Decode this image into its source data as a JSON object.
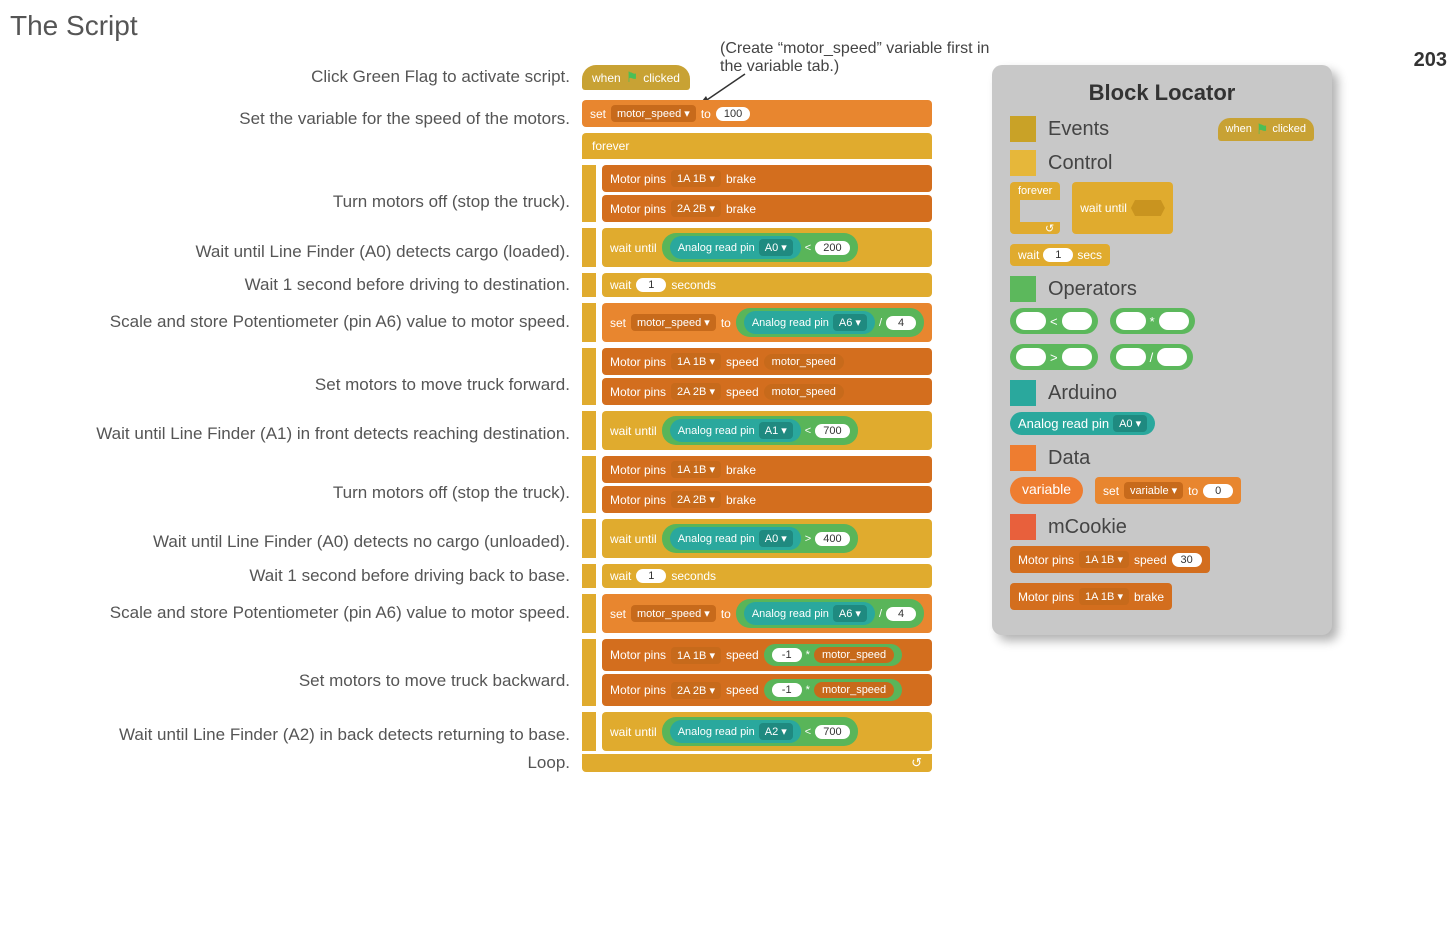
{
  "title": "The Script",
  "annot": "(Create “motor_speed” variable first in the variable tab.)",
  "pagenum": "203",
  "desc": [
    "Click Green Flag to activate script.",
    "Set the variable for the speed of the motors.",
    "",
    "Turn motors off (stop the truck).",
    "Wait until Line Finder (A0) detects cargo (loaded).",
    "Wait 1 second before driving to destination.",
    "Scale and store Potentiometer (pin A6) value to motor speed.",
    "Set motors to move truck forward.",
    "Wait until Line Finder (A1) in front detects reaching destination.",
    "Turn motors off (stop the truck).",
    "Wait until Line Finder (A0) detects no cargo (unloaded).",
    "Wait 1 second before driving back to base.",
    "Scale and store Potentiometer (pin A6) value to motor speed.",
    "Set motors to move truck backward.",
    "Wait until Line Finder (A2) in back detects returning to base.",
    "Loop."
  ],
  "blk": {
    "when": "when",
    "clicked": "clicked",
    "set": "set",
    "motor_speed": "motor_speed",
    "to": "to",
    "v100": "100",
    "forever": "forever",
    "motorpins": "Motor pins",
    "p1": "1A 1B",
    "p2": "2A 2B",
    "brake": "brake",
    "speed": "speed",
    "waituntil": "wait until",
    "analog": "Analog read pin",
    "A0": "A0",
    "A1": "A1",
    "A2": "A2",
    "A6": "A6",
    "lt": "<",
    "gt": ">",
    "mul": "*",
    "div": "/",
    "v200": "200",
    "v700": "700",
    "v400": "400",
    "v4": "4",
    "vneg1": "-1",
    "wait": "wait",
    "one": "1",
    "seconds": "seconds",
    "loop_arrow": "↺"
  },
  "loc": {
    "title": "Block Locator",
    "events": "Events",
    "control": "Control",
    "operators": "Operators",
    "arduino": "Arduino",
    "data": "Data",
    "mcookie": "mCookie",
    "secs": "secs",
    "variable": "variable",
    "set": "set",
    "varlabel": "variable",
    "to": "to",
    "zero": "0",
    "speed30": "30",
    "A0": "A0",
    "p1": "1A 1B"
  },
  "colors": {
    "events": "#c9a227",
    "control": "#e6b73a",
    "operators": "#5cb85c",
    "arduino": "#2aa89d",
    "data": "#ee7d30",
    "mcookie": "#e8603c"
  }
}
